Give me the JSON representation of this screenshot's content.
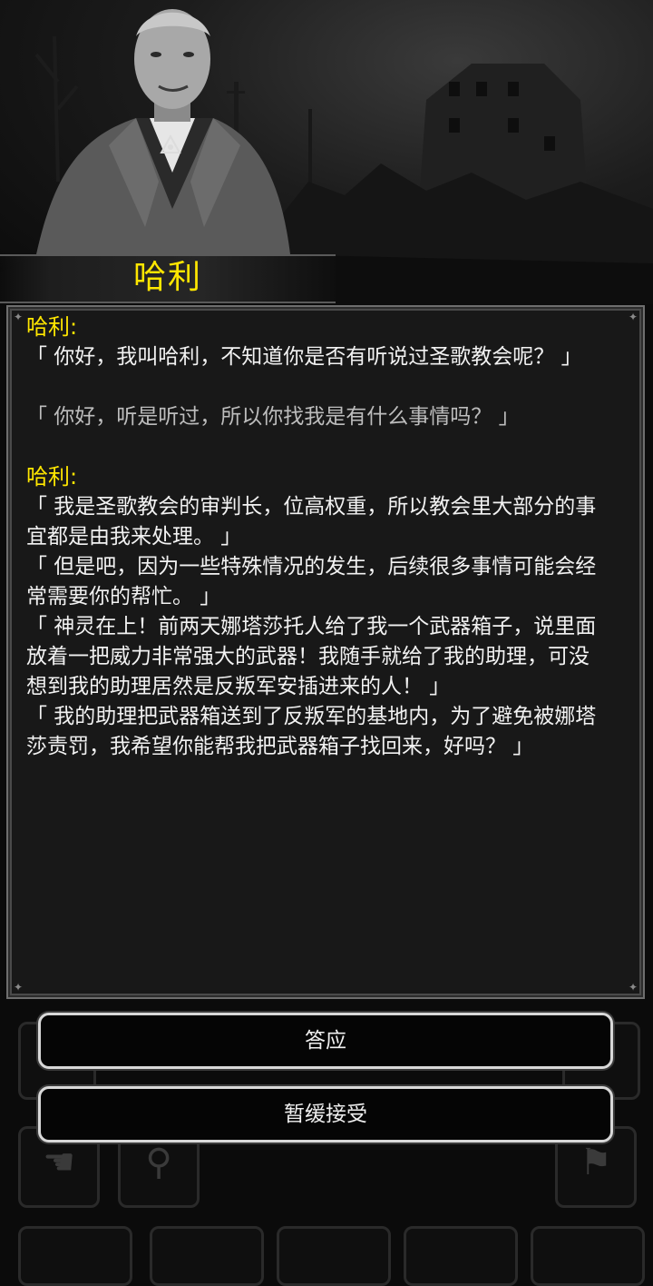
{
  "npc": {
    "name": "哈利"
  },
  "dialog": {
    "speaker1": "哈利:",
    "line1": "「 你好，我叫哈利，不知道你是否有听说过圣歌教会呢？ 」",
    "reply1": "「 你好，听是听过，所以你找我是有什么事情吗？ 」",
    "speaker2": "哈利:",
    "line2a": "「 我是圣歌教会的审判长，位高权重，所以教会里大部分的事",
    "line2b": "宜都是由我来处理。 」",
    "line3a": "「 但是吧，因为一些特殊情况的发生，后续很多事情可能会经",
    "line3b": "常需要你的帮忙。 」",
    "line4a": "「 神灵在上！前两天娜塔莎托人给了我一个武器箱子，说里面",
    "line4b": "放着一把威力非常强大的武器！我随手就给了我的助理，可没",
    "line4c": "想到我的助理居然是反叛军安插进来的人！ 」",
    "line5a": "「 我的助理把武器箱送到了反叛军的基地内，为了避免被娜塔",
    "line5b": "莎责罚，我希望你能帮我把武器箱子找回来，好吗？ 」"
  },
  "buttons": {
    "accept": "答应",
    "defer": "暂缓接受"
  },
  "colors": {
    "speaker": "#ffe600",
    "text": "#f2f2f2",
    "reply": "#bdbdbd",
    "panel": "#181818"
  }
}
